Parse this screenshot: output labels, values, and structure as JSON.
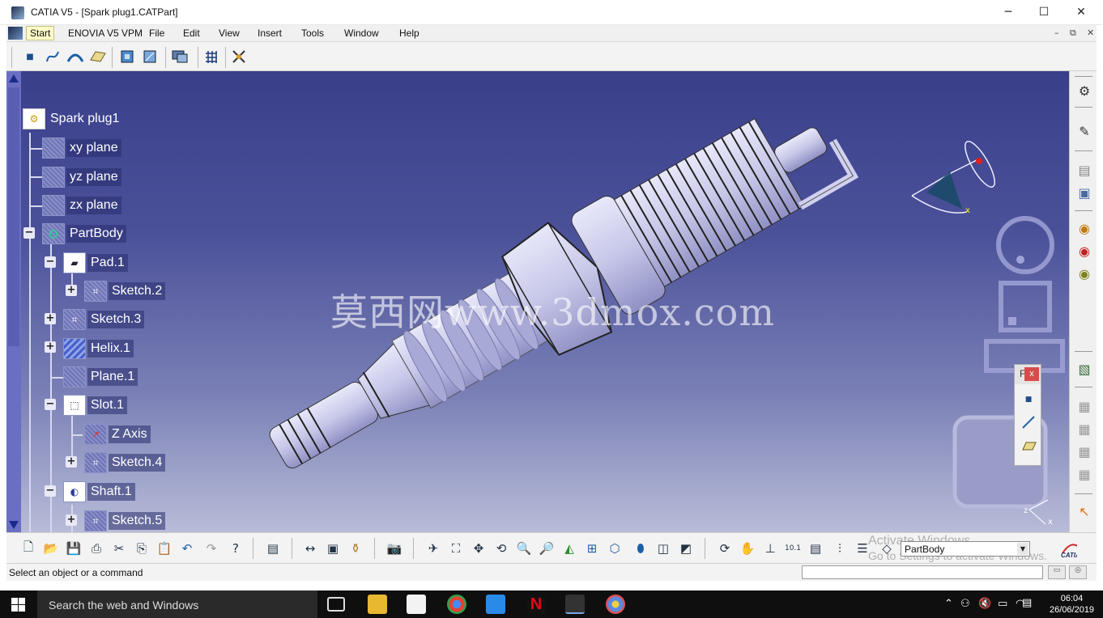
{
  "window": {
    "title": "CATIA V5 - [Spark plug1.CATPart]",
    "controls": {
      "minimize": "─",
      "maximize": "☐",
      "close": "✕"
    }
  },
  "menubar": {
    "items": [
      {
        "label": "Start"
      },
      {
        "label": "ENOVIA V5 VPM"
      },
      {
        "label": "File"
      },
      {
        "label": "Edit"
      },
      {
        "label": "View"
      },
      {
        "label": "Insert"
      },
      {
        "label": "Tools"
      },
      {
        "label": "Window"
      },
      {
        "label": "Help"
      }
    ],
    "mdi_controls": {
      "minimize": "–",
      "restore": "⧉",
      "close": "✕"
    }
  },
  "tree": {
    "root": {
      "label": "Spark plug1",
      "icon": "part-gear-icon"
    },
    "nodes": [
      {
        "label": "xy plane",
        "icon": "plane-icon"
      },
      {
        "label": "yz plane",
        "icon": "plane-icon"
      },
      {
        "label": "zx plane",
        "icon": "plane-icon"
      },
      {
        "label": "PartBody",
        "icon": "body-gear-icon",
        "expander": "−"
      },
      {
        "label": "Pad.1",
        "icon": "pad-icon",
        "expander": "−"
      },
      {
        "label": "Sketch.2",
        "icon": "sketch-icon",
        "expander": "+"
      },
      {
        "label": "Sketch.3",
        "icon": "sketch-icon",
        "expander": "+"
      },
      {
        "label": "Helix.1",
        "icon": "helix-icon",
        "expander": "+"
      },
      {
        "label": "Plane.1",
        "icon": "plane-icon"
      },
      {
        "label": "Slot.1",
        "icon": "slot-icon",
        "expander": "−"
      },
      {
        "label": "Z Axis",
        "icon": "axis-icon"
      },
      {
        "label": "Sketch.4",
        "icon": "sketch-icon",
        "expander": "+"
      },
      {
        "label": "Shaft.1",
        "icon": "shaft-icon",
        "expander": "−"
      },
      {
        "label": "Sketch.5",
        "icon": "sketch-icon",
        "expander": "+"
      }
    ]
  },
  "viewport": {
    "watermark": "莫西网www.3dmox.com",
    "axis_labels": {
      "x": "x",
      "z": "z"
    }
  },
  "floating_toolbar": {
    "title_char": "F",
    "close": "x"
  },
  "bottom_toolbar": {
    "current_body": "PartBody",
    "activation_notice": [
      "Activate Windows",
      "Go to Settings to activate Windows."
    ]
  },
  "status": {
    "message": "Select an object or a command"
  },
  "taskbar": {
    "search_placeholder": "Search the web and Windows",
    "time": "06:04",
    "date": "26/06/2019"
  },
  "colors": {
    "viewport_top": "#3a3f8a",
    "viewport_bottom": "#b8bcd8",
    "part_surface": "#c8c8ea",
    "tree_text": "#ffffff",
    "scrollbar": "#6a6fc4"
  }
}
